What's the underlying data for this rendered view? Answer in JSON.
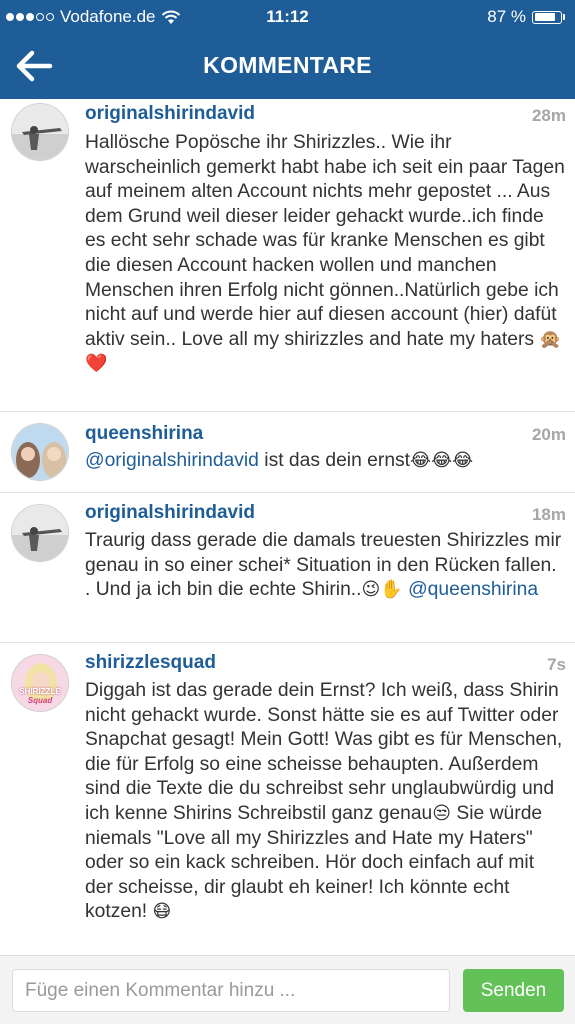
{
  "status_bar": {
    "carrier": "Vodafone.de",
    "signal_bars_filled": 3,
    "signal_bars_total": 5,
    "time": "11:12",
    "battery_text": "87 %",
    "battery_level": 0.87
  },
  "header": {
    "back_icon": "arrow-left-icon",
    "title": "KOMMENTARE",
    "background_color": "#1e5d97"
  },
  "comments": [
    {
      "username": "originalshirindavid",
      "timestamp": "28m",
      "text": "Hallösche Popösche ihr Shirizzles.. Wie ihr warscheinlich gemerkt habt habe ich seit ein paar Tagen auf meinem alten Account nichts mehr gepostet ... Aus dem Grund weil dieser leider gehackt wurde..ich finde es echt sehr schade was für kranke Menschen es gibt die diesen Account hacken wollen und manchen Menschen ihren Erfolg nicht gönnen..Natürlich gebe ich nicht auf und werde hier auf diesen account (hier) dafüt aktiv sein.. Love all my shirizzles and hate my haters",
      "emojis": "🙊❤️"
    },
    {
      "username": "queenshirina",
      "timestamp": "20m",
      "mention": "@originalshirindavid",
      "text": " ist das dein ernst",
      "emojis": "😂😂😂"
    },
    {
      "username": "originalshirindavid",
      "timestamp": "18m",
      "text": "Traurig dass gerade die damals treuesten Shirizzles mir genau in so einer schei* Situation in den Rücken fallen. . Und ja ich bin die echte Shirin..",
      "emojis": "😉✋",
      "mention": "@queenshirina"
    },
    {
      "username": "shirizzlesquad",
      "timestamp": "7s",
      "avatar_text": [
        "SHIRIZZLE",
        "Squad"
      ],
      "text_before": "Diggah ist das gerade dein Ernst? Ich weiß, dass Shirin nicht gehackt wurde. Sonst hätte sie es auf Twitter oder Snapchat gesagt! Mein Gott! Was gibt es für Menschen, die für Erfolg so eine scheisse behaupten. Außerdem sind die Texte die du schreibst sehr unglaubwürdig und ich kenne Shirins Schreibstil ganz genau",
      "emoji_mid": "😒",
      "text_after": " Sie würde niemals \"Love all my Shirizzles and Hate my Haters\" oder so ein kack schreiben. Hör doch einfach auf mit der scheisse, dir glaubt eh keiner! Ich könnte echt kotzen! ",
      "emoji_end": "😷"
    }
  ],
  "composer": {
    "placeholder": "Füge einen Kommentar hinzu ...",
    "send_label": "Senden",
    "send_color": "#62c257"
  }
}
